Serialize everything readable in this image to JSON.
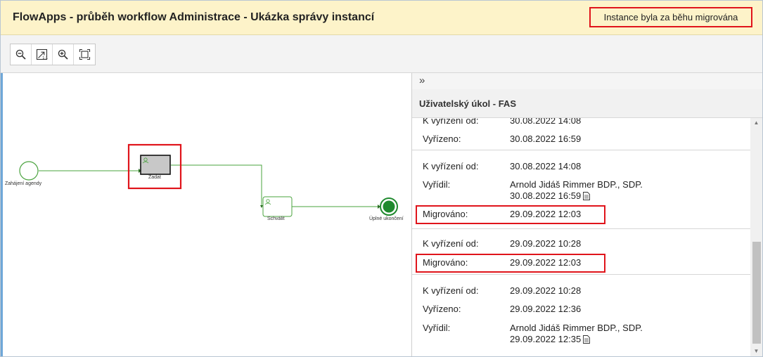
{
  "header": {
    "title": "FlowApps - průběh workflow Administrace - Ukázka správy instancí",
    "migration_notice": "Instance byla za běhu migrována"
  },
  "toolbar": {
    "buttons": [
      {
        "icon": "zoom-out-icon"
      },
      {
        "icon": "fit-to-screen-icon"
      },
      {
        "icon": "zoom-in-icon"
      },
      {
        "icon": "full-view-icon"
      }
    ]
  },
  "diagram": {
    "nodes": {
      "start": "Zahájení agendy",
      "task_submit": "Zadat",
      "task_approve": "Schválit",
      "end": "Úplné ukončení"
    },
    "colors": {
      "flow": "#4aa33e",
      "end_fill": "#1f8a2e",
      "task_active_fill": "#c8c8c8",
      "highlight": "#e0141b"
    }
  },
  "panel": {
    "collapse_icon": "»",
    "title": "Uživatelský úkol - FAS",
    "cards": [
      {
        "rows": [
          {
            "label": "K vyřízení od:",
            "value": "30.08.2022 14:08"
          },
          {
            "label": "Vyřízeno:",
            "value": "30.08.2022 16:59"
          }
        ]
      },
      {
        "rows": [
          {
            "label": "K vyřízení od:",
            "value": "30.08.2022 14:08"
          },
          {
            "label": "Vyřídil:",
            "value": "Arnold Jidáš Rimmer BDP., SDP.",
            "value2": "30.08.2022 16:59"
          },
          {
            "label": "Migrováno:",
            "value": "29.09.2022 12:03"
          }
        ]
      },
      {
        "rows": [
          {
            "label": "K vyřízení od:",
            "value": "29.09.2022 10:28"
          },
          {
            "label": "Migrováno:",
            "value": "29.09.2022 12:03"
          }
        ]
      },
      {
        "rows": [
          {
            "label": "K vyřízení od:",
            "value": "29.09.2022 10:28"
          },
          {
            "label": "Vyřízeno:",
            "value": "29.09.2022 12:36"
          },
          {
            "label": "Vyřídil:",
            "value": "Arnold Jidáš Rimmer BDP., SDP.",
            "value2": "29.09.2022 12:35"
          }
        ]
      }
    ]
  }
}
